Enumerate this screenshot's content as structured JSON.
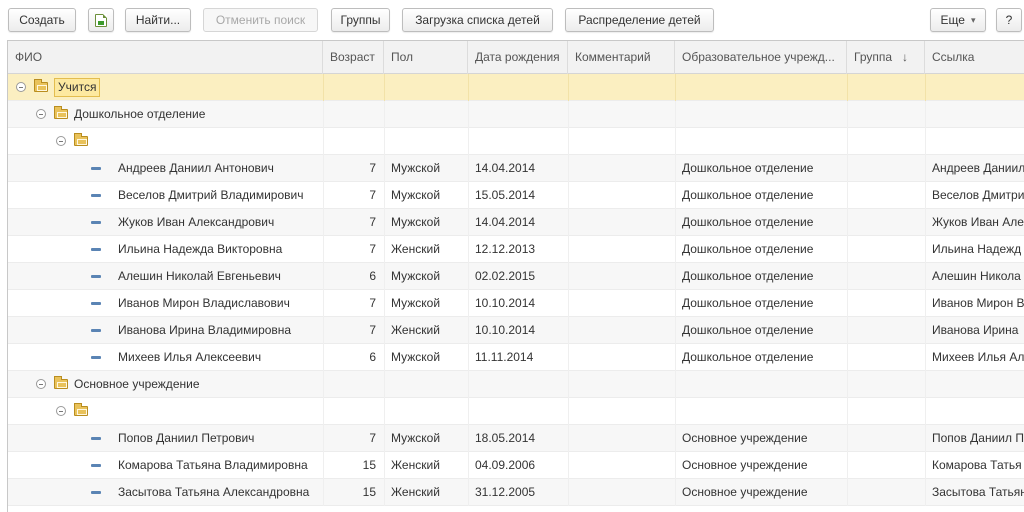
{
  "toolbar": {
    "create": "Создать",
    "find": "Найти...",
    "cancel_search": "Отменить поиск",
    "groups": "Группы",
    "load_children": "Загрузка списка детей",
    "distribute_children": "Распределение детей",
    "more": "Еще",
    "help": "?"
  },
  "columns": [
    "ФИО",
    "Возраст",
    "Пол",
    "Дата рождения",
    "Комментарий",
    "Образовательное учрежд...",
    "Группа",
    "Ссылка"
  ],
  "sort_indicator": "↓",
  "groups": {
    "root": "Учится",
    "preschool": "Дошкольное отделение",
    "main": "Основное учреждение"
  },
  "rows_preschool": [
    {
      "fio": "Андреев Даниил Антонович",
      "age": "7",
      "sex": "Мужской",
      "dob": "14.04.2014",
      "comment": "",
      "school": "Дошкольное отделение",
      "group": "",
      "link": "Андреев Даниил"
    },
    {
      "fio": "Веселов Дмитрий Владимирович",
      "age": "7",
      "sex": "Мужской",
      "dob": "15.05.2014",
      "comment": "",
      "school": "Дошкольное отделение",
      "group": "",
      "link": "Веселов Дмитри"
    },
    {
      "fio": "Жуков Иван Александрович",
      "age": "7",
      "sex": "Мужской",
      "dob": "14.04.2014",
      "comment": "",
      "school": "Дошкольное отделение",
      "group": "",
      "link": "Жуков Иван Але"
    },
    {
      "fio": "Ильина Надежда Викторовна",
      "age": "7",
      "sex": "Женский",
      "dob": "12.12.2013",
      "comment": "",
      "school": "Дошкольное отделение",
      "group": "",
      "link": "Ильина Надежд"
    },
    {
      "fio": "Алешин Николай Евгеньевич",
      "age": "6",
      "sex": "Мужской",
      "dob": "02.02.2015",
      "comment": "",
      "school": "Дошкольное отделение",
      "group": "",
      "link": "Алешин Никола"
    },
    {
      "fio": "Иванов Мирон Владиславович",
      "age": "7",
      "sex": "Мужской",
      "dob": "10.10.2014",
      "comment": "",
      "school": "Дошкольное отделение",
      "group": "",
      "link": "Иванов Мирон В"
    },
    {
      "fio": "Иванова Ирина Владимировна",
      "age": "7",
      "sex": "Женский",
      "dob": "10.10.2014",
      "comment": "",
      "school": "Дошкольное отделение",
      "group": "",
      "link": "Иванова Ирина"
    },
    {
      "fio": "Михеев Илья Алексеевич",
      "age": "6",
      "sex": "Мужской",
      "dob": "11.11.2014",
      "comment": "",
      "school": "Дошкольное отделение",
      "group": "",
      "link": "Михеев Илья Ал"
    }
  ],
  "rows_main": [
    {
      "fio": "Попов Даниил Петрович",
      "age": "7",
      "sex": "Мужской",
      "dob": "18.05.2014",
      "comment": "",
      "school": "Основное учреждение",
      "group": "",
      "link": "Попов Даниил П"
    },
    {
      "fio": "Комарова Татьяна Владимировна",
      "age": "15",
      "sex": "Женский",
      "dob": "04.09.2006",
      "comment": "",
      "school": "Основное учреждение",
      "group": "",
      "link": "Комарова Татья"
    },
    {
      "fio": "Засытова Татьяна Александровна",
      "age": "15",
      "sex": "Женский",
      "dob": "31.12.2005",
      "comment": "",
      "school": "Основное учреждение",
      "group": "",
      "link": "Засытова Татьян"
    }
  ],
  "colors": {
    "selected_row": "#fbefc1",
    "alt_row": "#f7f7f7",
    "item_icon": "#5a84b4",
    "folder": "#e9c25a"
  },
  "icons": {
    "add_copy": "copy-icon",
    "group_toggle": "collapse-icon",
    "group_folder": "folder-icon",
    "item": "item-dash-icon"
  }
}
